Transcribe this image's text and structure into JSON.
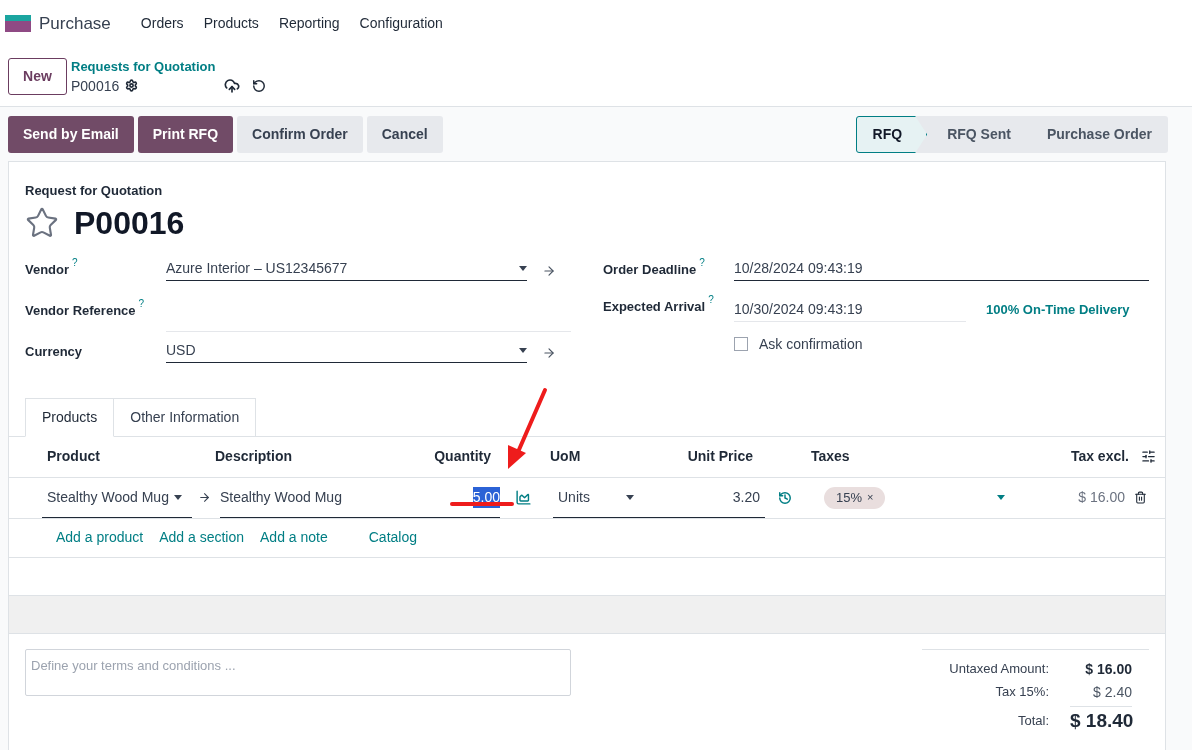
{
  "app": {
    "name": "Purchase",
    "menu": [
      "Orders",
      "Products",
      "Reporting",
      "Configuration"
    ]
  },
  "control_panel": {
    "new_button": "New",
    "breadcrumb_parent": "Requests for Quotation",
    "breadcrumb_current": "P00016"
  },
  "actions": [
    {
      "label": "Send by Email",
      "kind": "primary"
    },
    {
      "label": "Print RFQ",
      "kind": "primary"
    },
    {
      "label": "Confirm Order",
      "kind": "secondary"
    },
    {
      "label": "Cancel",
      "kind": "secondary"
    }
  ],
  "status_steps": [
    {
      "label": "RFQ",
      "selected": true
    },
    {
      "label": "RFQ Sent",
      "selected": false
    },
    {
      "label": "Purchase Order",
      "selected": false
    }
  ],
  "form": {
    "subtitle": "Request for Quotation",
    "title": "P00016",
    "starred": false,
    "left_fields": [
      {
        "label": "Vendor",
        "help": "?",
        "value": "Azure Interior – US12345677",
        "kind": "many2one"
      },
      {
        "label": "Vendor Reference",
        "help": "?",
        "kind": "text"
      },
      {
        "label": "Currency",
        "value": "USD",
        "kind": "many2one"
      }
    ],
    "right_fields": [
      {
        "label": "Order Deadline",
        "help": "?",
        "value": "10/28/2024 09:43:19",
        "kind": "date_wide"
      },
      {
        "label": "Expected Arrival",
        "help": "?",
        "value": "10/30/2024 09:43:19",
        "kind": "date_link",
        "link": "100% On-Time Delivery"
      }
    ],
    "ask_confirmation": {
      "label": "Ask confirmation",
      "checked": false
    }
  },
  "tabs": [
    {
      "label": "Products",
      "selected": true
    },
    {
      "label": "Other Information",
      "selected": false
    }
  ],
  "table": {
    "columns": [
      "Product",
      "Description",
      "Quantity",
      "UoM",
      "Unit Price",
      "Taxes",
      "Tax excl."
    ],
    "rows": [
      {
        "product": "Stealthy Wood Mug",
        "description": "Stealthy Wood Mug",
        "quantity": "5.00",
        "quantity_highlighted": true,
        "uom": "Units",
        "unit_price": "3.20",
        "tax_tag": "15%",
        "tax_remove": "×",
        "subtotal": "$ 16.00"
      }
    ],
    "add_links": [
      "Add a product",
      "Add a section",
      "Add a note",
      "Catalog"
    ]
  },
  "terms": {
    "placeholder": "Define your terms and conditions ..."
  },
  "totals": [
    {
      "label": "Untaxed Amount:",
      "value": "$ 16.00",
      "kind": "bold"
    },
    {
      "label": "Tax 15%:",
      "value": "$ 2.40",
      "kind": "normal"
    },
    {
      "label": "Total:",
      "value": "$ 18.40",
      "kind": "grand"
    }
  ]
}
